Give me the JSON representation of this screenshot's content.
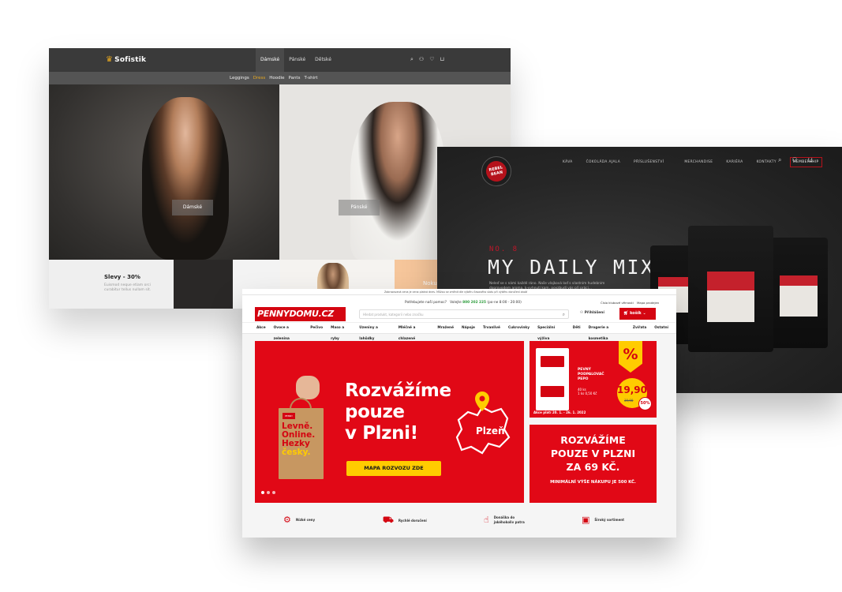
{
  "sofistik": {
    "brand": "Sofistik",
    "top_nav": [
      "Dámské",
      "Pánské",
      "Dětské"
    ],
    "sub_nav": [
      "Leggings",
      "Dress",
      "Hoodie",
      "Pants",
      "T-shirt"
    ],
    "hero_left_label": "Dámské",
    "hero_right_label": "Pánské",
    "sale_title": "Slevy - 30%",
    "sale_text": "Euismod neque etiam orci curabitur tellus nullam sit.",
    "tile_label": "Noku"
  },
  "rebel_bean": {
    "badge_text": "REBEL BEAN",
    "nav": [
      "KÁVA",
      "ČOKOLÁDA AJALA",
      "PŘÍSLUŠENSTVÍ",
      "MERCHANDISE",
      "KARIÉRA",
      "KONTAKTY",
      "MEMBERSHIP"
    ],
    "kicker": "NO. 8",
    "headline": "MY DAILY MIX",
    "description": "Neleď se s námi každé ráno. Naše vlajková loď s vlastním hudebním doprovodem aroma, k-vyhnutí kam, povzbudí vás při práci..."
  },
  "penny": {
    "notice": "Zobrazovaná cena je cena platná dnes. Můžou se změnit dle výběru časového slotu při výběru doručení zboží",
    "help_label": "Potřebujete naší pomoc?",
    "help_call": "Volejte",
    "help_phone": "800 202 225",
    "help_hours": "(po-ne 8:00 - 20:00)",
    "logo": "PENNYDOMU.CZ",
    "search_placeholder": "Hledat produkt, kategorii nebo značku",
    "customer_card": "Číslo klubové věrnosti",
    "shop_map": "Mapa prodejen",
    "login": "Přihlášení",
    "cart": "košík",
    "categories": [
      "Akce",
      "Ovoce a zelenina",
      "Pečivo",
      "Maso a ryby",
      "Uzeniny a lahůdky",
      "Mléčné a chlazené",
      "Mražené",
      "Nápoje",
      "Trvanlivé",
      "Cukrovinky",
      "Speciální výživa",
      "Děti",
      "Drogerie a kosmetika",
      "Zvířata",
      "Ostatní"
    ],
    "bag_lines": [
      "Levně.",
      "Online.",
      "Hezky",
      "česky."
    ],
    "bag_brand": "PENNY",
    "banner_lines": [
      "Rozvážíme",
      "pouze",
      "v Plzni!"
    ],
    "city": "Plzeň",
    "map_button": "MAPA ROZVOZU ZDE",
    "promo_product": [
      "PEVNÝ",
      "PODPALOVAČ",
      "PEPO"
    ],
    "promo_qty": "40 ks",
    "promo_unit": "1 ks 0,50 Kč",
    "promo_valid": "Akce platí 20. 1. - 26. 1. 2022",
    "promo_percent": "%",
    "promo_price": "19,90",
    "promo_old_price": "39,90",
    "promo_save": "50%",
    "info_lines": [
      "ROZVÁŽÍME",
      "POUZE V PLZNI",
      "ZA 69 KČ."
    ],
    "info_min": "MINIMÁLNÍ VÝŠE NÁKUPU JE 500 KČ.",
    "features": [
      {
        "icon": "percent-icon",
        "label": "Nízké ceny"
      },
      {
        "icon": "truck-icon",
        "label": "Rychlé doručení"
      },
      {
        "icon": "delivery-hand-icon",
        "label": "Donáška do jakéhokoliv patra"
      },
      {
        "icon": "assortment-icon",
        "label": "Široký sortiment"
      }
    ],
    "accent": "#e10816",
    "yellow": "#ffcc00"
  }
}
